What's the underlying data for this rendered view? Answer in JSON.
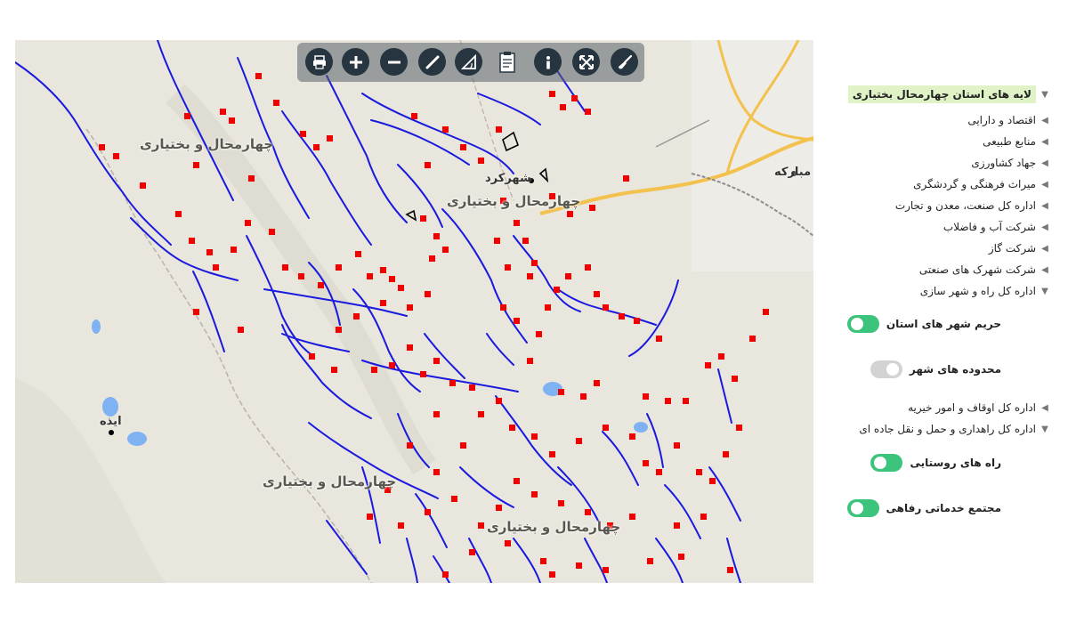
{
  "map": {
    "labels": {
      "province_nw": "چهارمحال و بختیاری",
      "province_center": "چهارمحال و بختیاری",
      "province_sw": "چهارمحال و بختیاری",
      "province_s": "چهارمحال و بختیاری",
      "city_shahrekord": "شهرکرد",
      "city_mobarakeh": "مبارکه",
      "city_izeh": "ایذه"
    },
    "colors": {
      "background": "#e9e6dd",
      "rivers": "#1a1adf",
      "markers": "#f00000",
      "roads_major": "#f2c14e",
      "water": "#7fb2f2"
    }
  },
  "toolbar": {
    "buttons": [
      "print-icon",
      "zoom-in-icon",
      "zoom-out-icon",
      "draw-line-icon",
      "measure-angle-icon",
      "report-icon",
      "info-icon",
      "full-extent-icon",
      "clear-icon"
    ]
  },
  "layers": {
    "root": "لایه های استان چهارمحال بختیاری",
    "groups": [
      "اقتصاد و دارایی",
      "منابع طبیعی",
      "جهاد کشاورزی",
      "میراث فرهنگی و گردشگری",
      "اداره کل صنعت، معدن و تجارت",
      "شرکت آب و فاضلاب",
      "شرکت گاز",
      "شرکت شهرک های صنعتی",
      "اداره کل راه و شهر سازی"
    ],
    "roads_children": [
      {
        "label": "حریم شهر های استان",
        "state": "on"
      },
      {
        "label": "محدوده های شهر",
        "state": "off"
      }
    ],
    "awqaf": "اداره کل اوقاف و امور خیریه",
    "transport": "اداره کل راهداری و حمل و نقل جاده ای",
    "transport_children": [
      {
        "label": "راه های روستایی",
        "state": "on"
      },
      {
        "label": "مجتمع خدماتی رفاهی",
        "state": "on"
      }
    ]
  }
}
